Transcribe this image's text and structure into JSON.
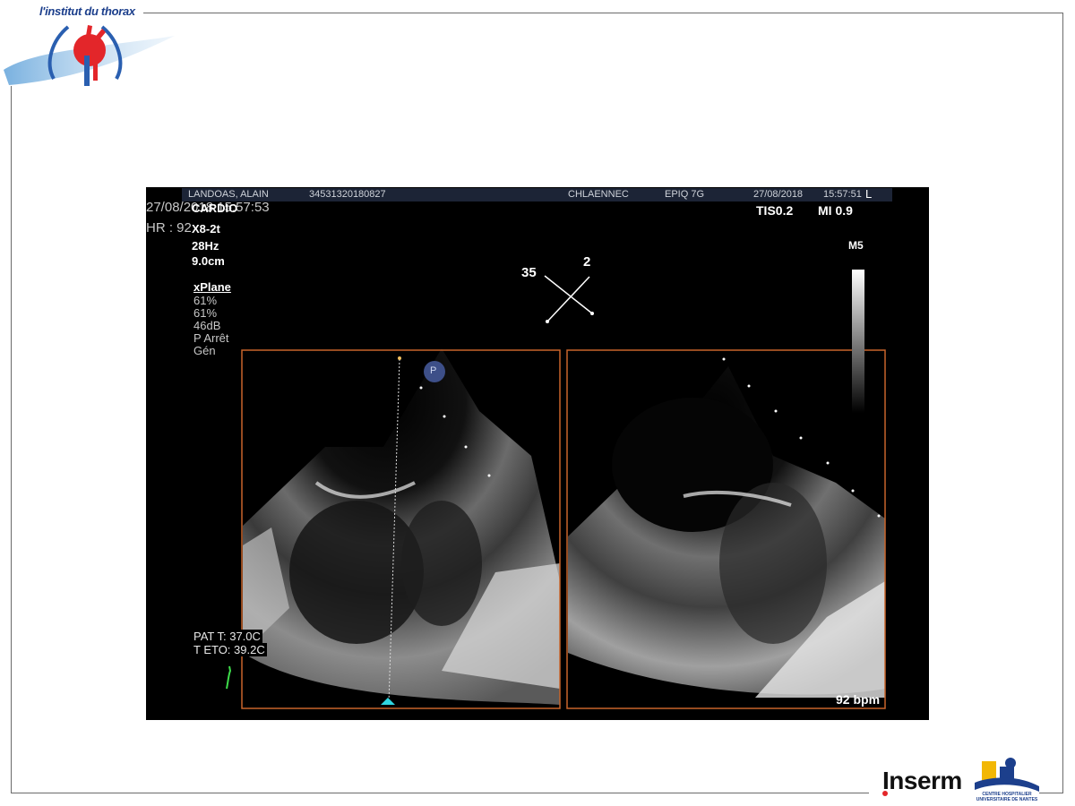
{
  "logo": {
    "title": "l'institut du thorax"
  },
  "echo": {
    "header": {
      "patient": "LANDOAS, ALAIN",
      "id": "34531320180827",
      "site": "CHLAENNEC",
      "device": "EPIQ 7G",
      "date": "27/08/2018",
      "time": "15:57:51",
      "marker": "L"
    },
    "overlay_timestamp": "27/08/2018 15:57:53",
    "overlay_hr": "HR : 92",
    "preset": "CARDIO",
    "probe": "X8-2t",
    "frame_rate": "28Hz",
    "depth": "9.0cm",
    "mode": "xPlane",
    "params": [
      "61%",
      "61%",
      "46dB",
      "P Arrêt",
      "Gén"
    ],
    "tis": "TIS0.2",
    "mi": "MI 0.9",
    "map": "M5",
    "angle_left": "35",
    "angle_right": "2",
    "pat_temp": "PAT T: 37.0C",
    "teto_temp": "T ETO: 39.2C",
    "bpm": "92 bpm",
    "p_marker": "P"
  },
  "colors": {
    "border_orange": "#c8642a",
    "marker_cyan": "#2fd6e0",
    "ecg_green": "#3ddc4a",
    "logo_red": "#e3262a",
    "logo_blue": "#1c3f8c"
  }
}
